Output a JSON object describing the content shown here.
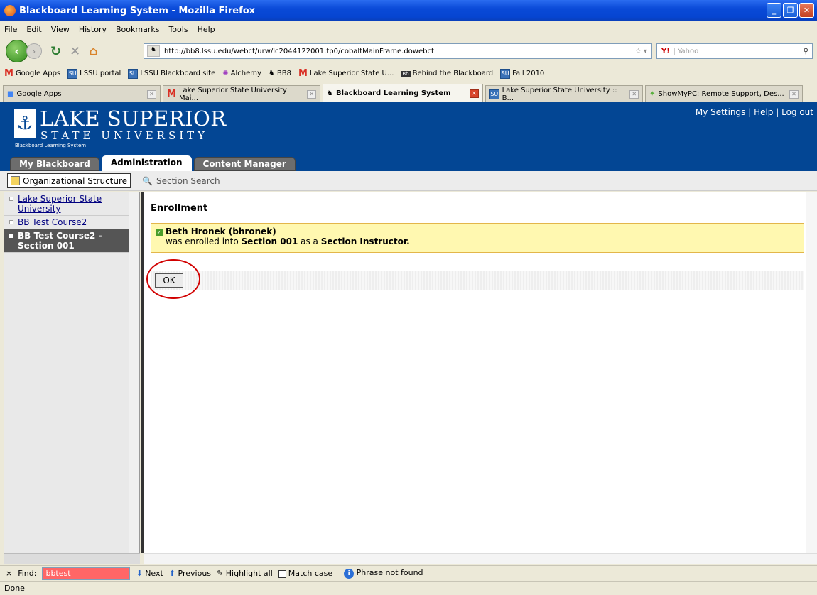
{
  "window": {
    "title": "Blackboard Learning System - Mozilla Firefox"
  },
  "menu": [
    "File",
    "Edit",
    "View",
    "History",
    "Bookmarks",
    "Tools",
    "Help"
  ],
  "nav": {
    "url": "http://bb8.lssu.edu/webct/urw/lc2044122001.tp0/cobaltMainFrame.dowebct",
    "search_engine": "Y!",
    "search_placeholder": "Yahoo"
  },
  "bookmarks": [
    "Google Apps",
    "LSSU portal",
    "LSSU Blackboard site",
    "Alchemy",
    "BB8",
    "Lake Superior State U...",
    "Behind the Blackboard",
    "Fall 2010"
  ],
  "tabs": [
    {
      "label": "Google Apps",
      "active": false
    },
    {
      "label": "Lake Superior State University Mai...",
      "active": false
    },
    {
      "label": "Blackboard Learning System",
      "active": true
    },
    {
      "label": "Lake Superior State University :: B...",
      "active": false
    },
    {
      "label": "ShowMyPC: Remote Support, Des...",
      "active": false
    }
  ],
  "header": {
    "logo_title": "LAKE SUPERIOR",
    "logo_sub": "STATE UNIVERSITY",
    "logo_small": "Blackboard Learning System",
    "links": [
      "My Settings",
      "Help",
      "Log out"
    ],
    "main_tabs": [
      {
        "label": "My Blackboard"
      },
      {
        "label": "Administration"
      },
      {
        "label": "Content Manager"
      }
    ]
  },
  "subtoolbar": {
    "org": "Organizational Structure",
    "search": "Section Search"
  },
  "tree": [
    {
      "label": "Lake Superior State University",
      "selected": false
    },
    {
      "label": "BB Test Course2",
      "selected": false
    },
    {
      "label": "BB Test Course2 - Section 001",
      "selected": true
    }
  ],
  "content": {
    "title": "Enrollment",
    "user": "Beth Hronek (bhronek)",
    "msg_prefix": "was enrolled into ",
    "section": "Section 001",
    "msg_mid": " as a ",
    "role": "Section Instructor",
    "msg_suffix": ".",
    "ok": "OK"
  },
  "findbar": {
    "close": "×",
    "find_label": "Find:",
    "find_value": "bbtest",
    "next": "Next",
    "previous": "Previous",
    "highlight": "Highlight all",
    "match_case": "Match case",
    "status": "Phrase not found"
  },
  "statusbar": {
    "text": "Done"
  }
}
